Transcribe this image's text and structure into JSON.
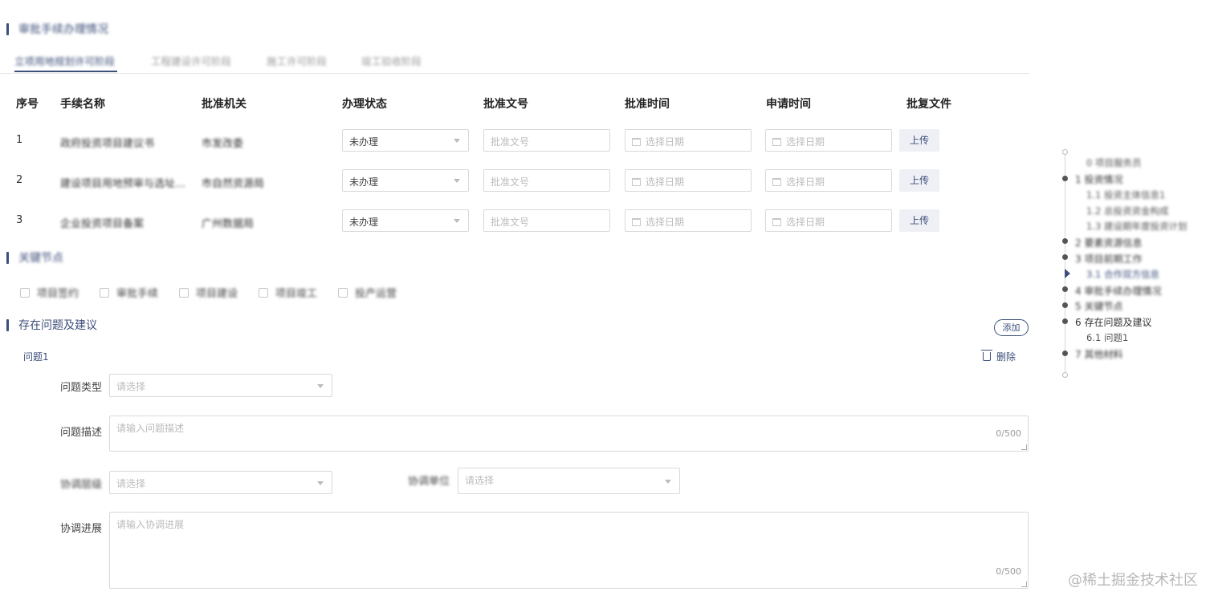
{
  "sections": {
    "approval_title": "审批手续办理情况",
    "nodes_title": "关键节点",
    "problems_title": "存在问题及建议"
  },
  "tabs": [
    {
      "label": "立项用地规划许可阶段",
      "active": true
    },
    {
      "label": "工程建设许可阶段",
      "active": false
    },
    {
      "label": "施工许可阶段",
      "active": false
    },
    {
      "label": "竣工验收阶段",
      "active": false
    }
  ],
  "table": {
    "headers": [
      "序号",
      "手续名称",
      "批准机关",
      "办理状态",
      "批准文号",
      "批准时间",
      "申请时间",
      "批复文件"
    ],
    "rows": [
      {
        "no": "1",
        "name": "政府投资项目建议书",
        "org": "市发改委",
        "status": "未办理"
      },
      {
        "no": "2",
        "name": "建设项目用地预审与选址…",
        "org": "市自然资源局",
        "status": "未办理"
      },
      {
        "no": "3",
        "name": "企业投资项目备案",
        "org": "广州数据局",
        "status": "未办理"
      }
    ],
    "doc_placeholder": "批准文号",
    "date_placeholder": "选择日期",
    "upload_label": "上传"
  },
  "nodes": [
    "项目签约",
    "审批手续",
    "项目建设",
    "项目竣工",
    "投产运营"
  ],
  "problems": {
    "add_label": "添加",
    "item_title": "问题1",
    "delete_label": "删除",
    "type_label": "问题类型",
    "type_placeholder": "请选择",
    "desc_label": "问题描述",
    "desc_placeholder": "请输入问题描述",
    "desc_count": "0/500",
    "level_label": "协调层级",
    "level_placeholder": "请选择",
    "unit_label": "协调单位",
    "unit_placeholder": "请选择",
    "progress_label": "协调进展",
    "progress_placeholder": "请输入协调进展",
    "progress_count": "0/500"
  },
  "anchor_nav": [
    {
      "label": "0  项目服务员",
      "level": "sub"
    },
    {
      "label": "1  投资情况",
      "level": "main"
    },
    {
      "label": "1.1  投资主体信息1",
      "level": "sub"
    },
    {
      "label": "1.2  总投资资金构成",
      "level": "sub"
    },
    {
      "label": "1.3  建设期年度投资计划",
      "level": "sub"
    },
    {
      "label": "2  要素资源信息",
      "level": "main"
    },
    {
      "label": "3  项目前期工作",
      "level": "main"
    },
    {
      "label": "3.1  合作双方信息",
      "level": "sub-active"
    },
    {
      "label": "4  审批手续办理情况",
      "level": "main"
    },
    {
      "label": "5  关键节点",
      "level": "main"
    },
    {
      "label": "6  存在问题及建议",
      "level": "main"
    },
    {
      "label": "6.1  问题1",
      "level": "sub"
    },
    {
      "label": "7  其他材料",
      "level": "main"
    }
  ],
  "watermark": "@稀土掘金技术社区",
  "colors": {
    "accent": "#3d4f7a",
    "border": "#d9d9d9",
    "placeholder": "#bbbbbb"
  }
}
